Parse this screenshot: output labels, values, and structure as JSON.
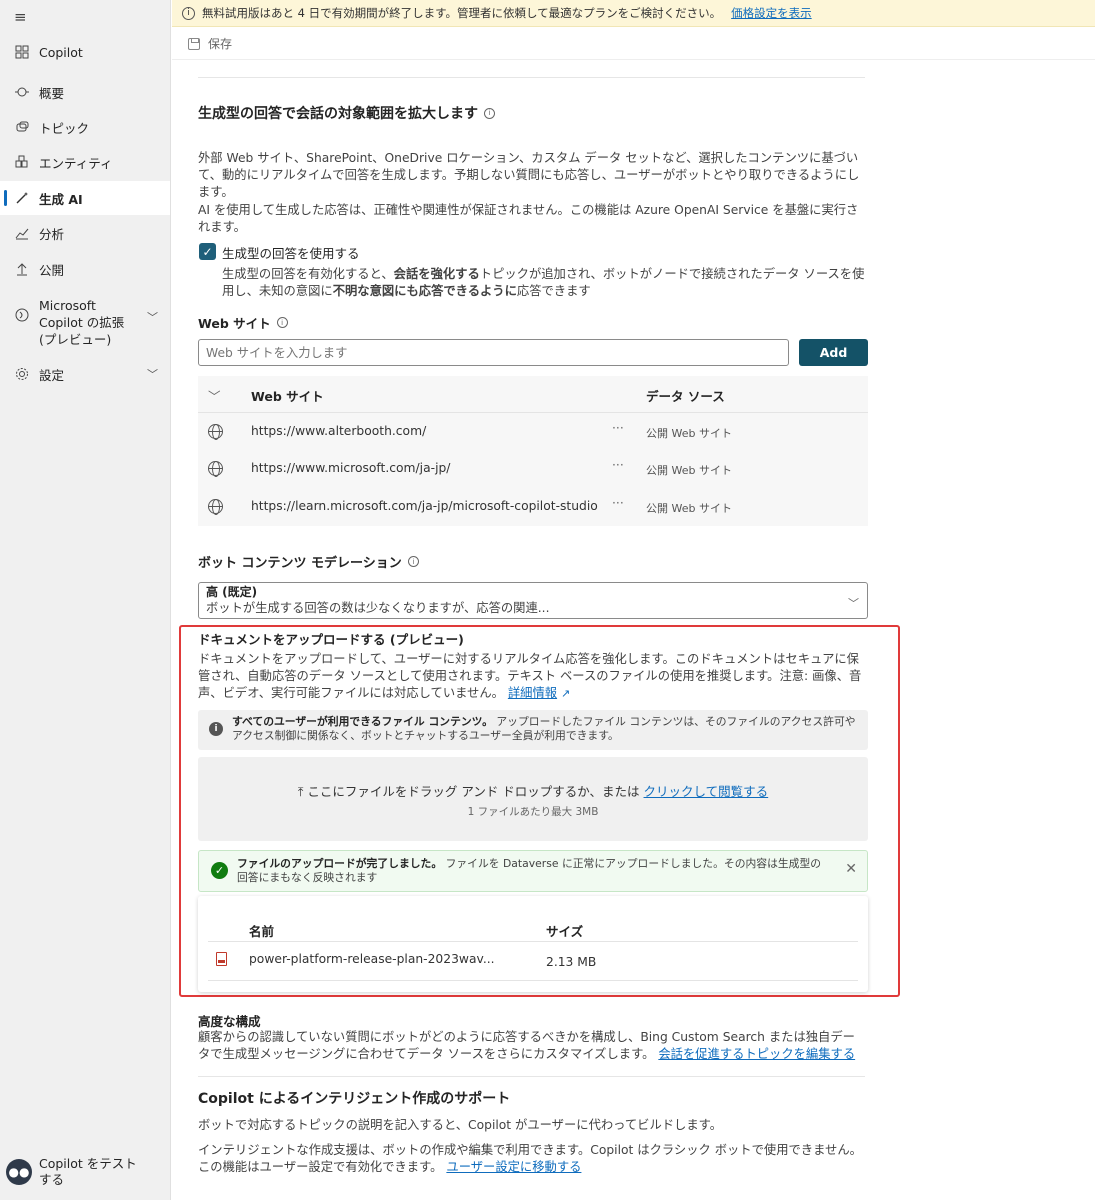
{
  "sidebar": {
    "items": [
      {
        "label": "Copilot",
        "icon": "grid-icon"
      },
      {
        "label": "概要",
        "icon": "overview-icon"
      },
      {
        "label": "トピック",
        "icon": "topics-icon"
      },
      {
        "label": "エンティティ",
        "icon": "entity-icon"
      },
      {
        "label": "生成 AI",
        "icon": "wand-icon"
      },
      {
        "label": "分析",
        "icon": "chart-icon"
      },
      {
        "label": "公開",
        "icon": "upload-icon"
      },
      {
        "label": "Microsoft Copilot の拡張 (プレビュー)",
        "icon": "plugin-icon"
      },
      {
        "label": "設定",
        "icon": "gear-icon"
      }
    ],
    "test_bot": "Copilot をテストする"
  },
  "banner": {
    "text": "無料試用版はあと 4 日で有効期間が終了します。管理者に依頼して最適なプランをご検討ください。",
    "link": "価格設定を表示"
  },
  "toolbar": {
    "save": "保存"
  },
  "gen": {
    "title": "生成型の回答で会話の対象範囲を拡大します",
    "desc1": "外部 Web サイト、SharePoint、OneDrive ロケーション、カスタム データ セットなど、選択したコンテンツに基づいて、動的にリアルタイムで回答を生成します。予期しない質問にも応答し、ユーザーがボットとやり取りできるようにします。",
    "desc2": "AI を使用して生成した応答は、正確性や関連性が保証されません。この機能は Azure OpenAI Service を基盤に実行されます。",
    "checkbox_label": "生成型の回答を使用する",
    "check_desc_a": "生成型の回答を有効化すると、",
    "check_desc_b": "会話を強化する",
    "check_desc_c": "トピックが追加され、ボットがノードで接続されたデータ ソースを使用し、未知の意図に",
    "check_desc_d": "不明な意図にも応答できるように",
    "check_desc_e": "応答できます"
  },
  "web": {
    "label": "Web サイト",
    "placeholder": "Web サイトを入力します",
    "add": "Add",
    "col_site": "Web サイト",
    "col_source": "データ ソース",
    "rows": [
      {
        "url": "https://www.alterbooth.com/",
        "source": "公開 Web サイト"
      },
      {
        "url": "https://www.microsoft.com/ja-jp/",
        "source": "公開 Web サイト"
      },
      {
        "url": "https://learn.microsoft.com/ja-jp/microsoft-copilot-studio",
        "source": "公開 Web サイト"
      }
    ]
  },
  "moderation": {
    "label": "ボット コンテンツ モデレーション",
    "selected": "高 (既定)",
    "selected_desc": "ボットが生成する回答の数は少なくなりますが、応答の関連..."
  },
  "upload": {
    "title": "ドキュメントをアップロードする (プレビュー)",
    "desc": "ドキュメントをアップロードして、ユーザーに対するリアルタイム応答を強化します。このドキュメントはセキュアに保管され、自動応答のデータ ソースとして使用されます。テキスト ベースのファイルの使用を推奨します。注意: 画像、音声、ビデオ、実行可能ファイルには対応していません。",
    "more": "詳細情報",
    "notice_bold": "すべてのユーザーが利用できるファイル コンテンツ。",
    "notice": "アップロードしたファイル コンテンツは、そのファイルのアクセス許可やアクセス制御に関係なく、ボットとチャットするユーザー全員が利用できます。",
    "drop_text": "ここにファイルをドラッグ アンド ドロップするか、または",
    "drop_link": "クリックして閲覧する",
    "max": "1 ファイルあたり最大 3MB",
    "success_bold": "ファイルのアップロードが完了しました。",
    "success": "ファイルを Dataverse に正常にアップロードしました。その内容は生成型の回答にまもなく反映されます",
    "col_name": "名前",
    "col_size": "サイズ",
    "file_name": "power-platform-release-plan-2023wav...",
    "file_size": "2.13 MB"
  },
  "advanced": {
    "title": "高度な構成",
    "desc": "顧客からの認識していない質問にボットがどのように応答するべきかを構成し、Bing Custom Search または独自データで生成型メッセージングに合わせてデータ ソースをさらにカスタマイズします。",
    "link": "会話を促進するトピックを編集する"
  },
  "copilot": {
    "title": "Copilot によるインテリジェント作成のサポート",
    "desc1": "ボットで対応するトピックの説明を記入すると、Copilot がユーザーに代わってビルドします。",
    "desc2": "インテリジェントな作成支援は、ボットの作成や編集で利用できます。Copilot はクラシック ボットで使用できません。この機能はユーザー設定で有効化できます。",
    "link": "ユーザー設定に移動する"
  },
  "colors": {
    "accent": "#145267",
    "highlight": "#e03a3a",
    "success": "#107c10"
  }
}
